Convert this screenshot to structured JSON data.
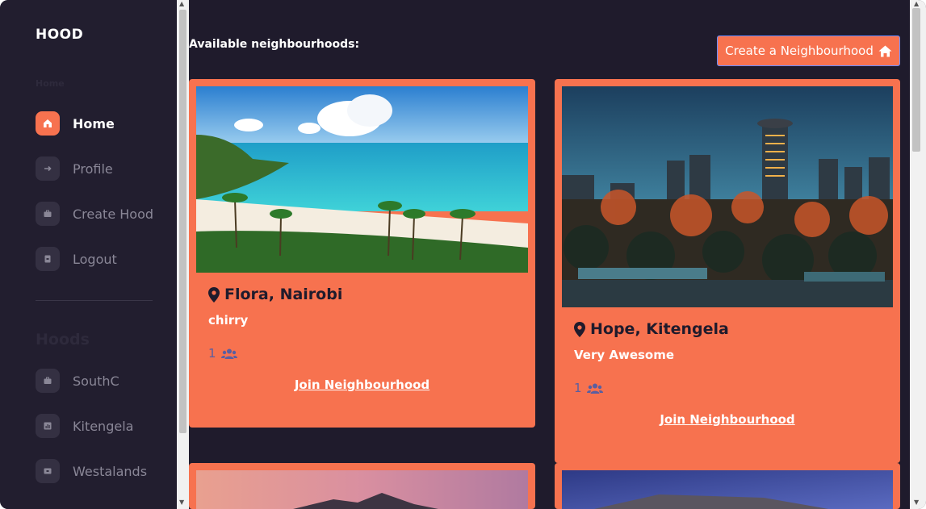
{
  "sidebar": {
    "brand": "HOOD",
    "top_label": "Home",
    "items": [
      {
        "label": "Home",
        "icon": "home-icon",
        "active": true
      },
      {
        "label": "Profile",
        "icon": "arrow-right-icon",
        "active": false
      },
      {
        "label": "Create Hood",
        "icon": "briefcase-icon",
        "active": false
      },
      {
        "label": "Logout",
        "icon": "logout-icon",
        "active": false
      }
    ],
    "hoods_label": "Hoods",
    "hoods": [
      {
        "label": "SouthC",
        "icon": "briefcase-icon"
      },
      {
        "label": "Kitengela",
        "icon": "chart-icon"
      },
      {
        "label": "Westalands",
        "icon": "briefcase-icon"
      }
    ]
  },
  "main": {
    "heading": "Available neighbourhoods:",
    "create_button": "Create a Neighbourhood",
    "cards": [
      {
        "title": "Flora, Nairobi",
        "description": "chirry",
        "members": "1",
        "join": "Join Neighbourhood"
      },
      {
        "title": "Hope, Kitengela",
        "description": "Very Awesome",
        "members": "1",
        "join": "Join Neighbourhood"
      }
    ]
  },
  "colors": {
    "accent": "#f7724f",
    "background": "#1f1b2c",
    "sidebar": "#221e2f"
  }
}
